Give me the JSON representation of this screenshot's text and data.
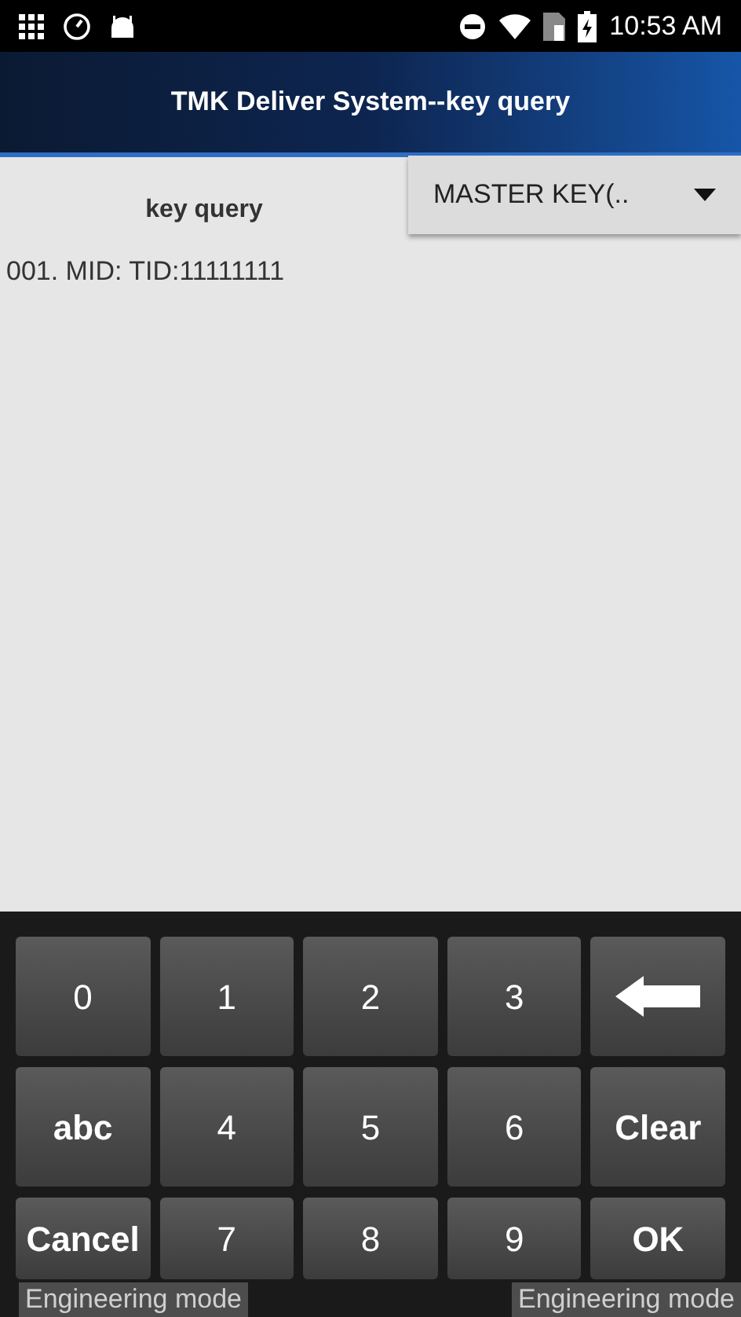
{
  "status_bar": {
    "time": "10:53 AM"
  },
  "header": {
    "title": "TMK Deliver System--key query"
  },
  "query": {
    "label": "key query",
    "dropdown": {
      "value": "MASTER KEY(.."
    }
  },
  "results": [
    "001.  MID:  TID:11111111"
  ],
  "keypad": [
    [
      {
        "kind": "digit",
        "label": "0"
      },
      {
        "kind": "digit",
        "label": "1"
      },
      {
        "kind": "digit",
        "label": "2"
      },
      {
        "kind": "digit",
        "label": "3"
      },
      {
        "kind": "backspace"
      }
    ],
    [
      {
        "kind": "action",
        "label": "abc"
      },
      {
        "kind": "digit",
        "label": "4"
      },
      {
        "kind": "digit",
        "label": "5"
      },
      {
        "kind": "digit",
        "label": "6"
      },
      {
        "kind": "action",
        "label": "Clear"
      }
    ],
    [
      {
        "kind": "action",
        "label": "Cancel"
      },
      {
        "kind": "digit",
        "label": "7"
      },
      {
        "kind": "digit",
        "label": "8"
      },
      {
        "kind": "digit",
        "label": "9"
      },
      {
        "kind": "action",
        "label": "OK"
      }
    ]
  ],
  "overlays": [
    "Engineering mode",
    "Engineering mode"
  ]
}
